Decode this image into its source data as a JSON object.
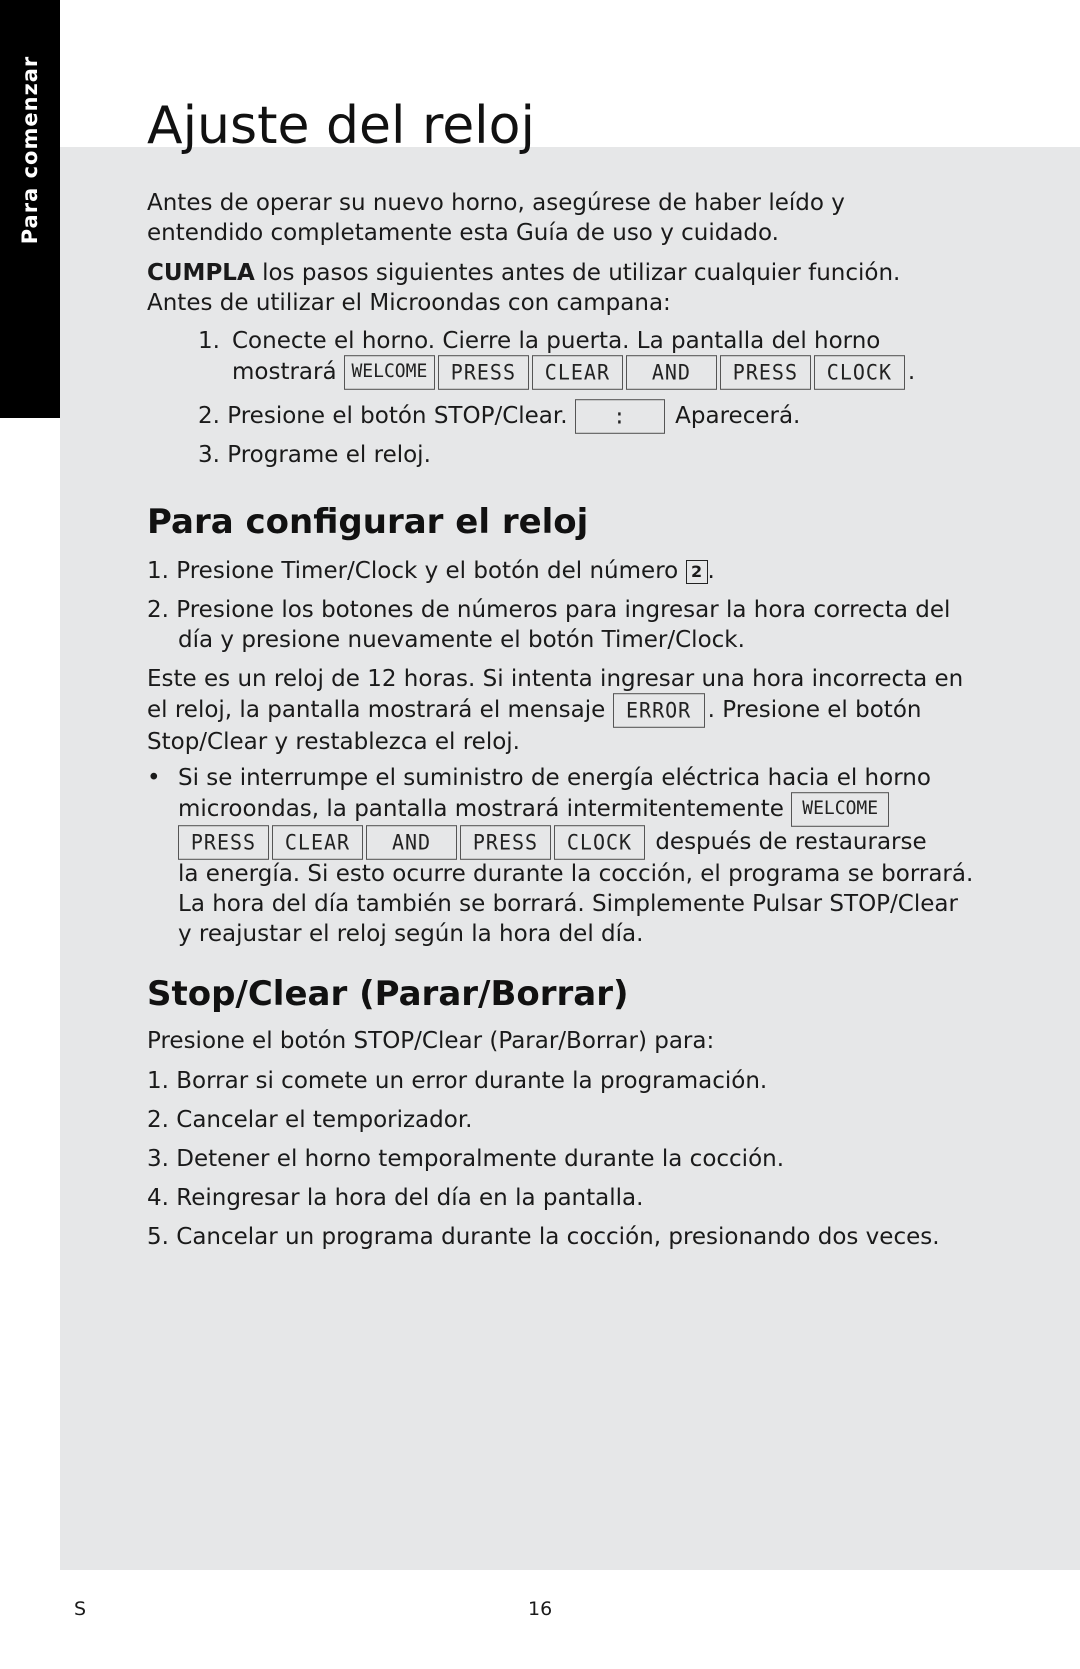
{
  "side_tab": {
    "label": "Para comenzar"
  },
  "title": "Ajuste del reloj",
  "intro": {
    "p1": "Antes de operar su nuevo horno, asegúrese de haber leído y entendido completamente esta Guía de uso y cuidado.",
    "p2_bold": "CUMPLA",
    "p2_rest": " los pasos siguientes antes de utilizar cualquier función. Antes de utilizar el Microondas con campana:"
  },
  "steps": [
    {
      "num": "1.",
      "line1": "Conecte el horno. Cierre la puerta. La pantalla del horno",
      "line2": "mostrará",
      "end": "."
    },
    {
      "num": "2.",
      "text": "Presione el botón STOP/Clear.",
      "after": "Aparecerá."
    },
    {
      "num": "3.",
      "text": "Programe el reloj."
    }
  ],
  "display_sequence": [
    "WELCOME",
    "PRESS",
    "CLEAR",
    "AND",
    "PRESS",
    "CLOCK"
  ],
  "colon_display": ":",
  "section_configure": {
    "heading": "Para configurar el reloj",
    "items": [
      {
        "num": "1.",
        "text": "Presione Timer/Clock y el botón del número",
        "key": "2",
        "end": "."
      },
      {
        "num": "2.",
        "line1": "Presione los botones de números para ingresar la hora correcta del",
        "line2": "día y presione nuevamente el botón Timer/Clock."
      }
    ],
    "note": {
      "line1": "Este es un reloj de 12 horas. Si intenta ingresar una hora incorrecta en",
      "line2_pre": "el reloj, la pantalla mostrará el mensaje",
      "error_display": "ERROR",
      "line2_post": ". Presione el botón",
      "line3": "Stop/Clear y restablezca el reloj."
    },
    "bullet": {
      "symbol": "•",
      "line1": "Si se interrumpe el suministro de energía eléctrica hacia el horno",
      "line2": "microondas, la pantalla mostrará intermitentemente",
      "line3_post": "después de restaurarse",
      "line4": "la energía. Si esto ocurre durante la cocción, el programa se borrará.",
      "line5": "La hora del día también se borrará. Simplemente Pulsar STOP/Clear",
      "line6": "y reajustar el reloj según la hora del día."
    }
  },
  "section_stop": {
    "heading": "Stop/Clear (Parar/Borrar)",
    "intro": "Presione el botón STOP/Clear (Parar/Borrar) para:",
    "items": [
      {
        "num": "1.",
        "text": "Borrar si comete un error durante la programación."
      },
      {
        "num": "2.",
        "text": "Cancelar el temporizador."
      },
      {
        "num": "3.",
        "text": "Detener el horno temporalmente durante la cocción."
      },
      {
        "num": "4.",
        "text": "Reingresar la hora del día en la pantalla."
      },
      {
        "num": "5.",
        "text": "Cancelar un programa durante la cocción, presionando dos veces."
      }
    ]
  },
  "footer": {
    "left": "S",
    "page": "16"
  },
  "colors": {
    "panel": "#e6e7e8",
    "tab": "#000000",
    "text": "#1a1a1a"
  }
}
